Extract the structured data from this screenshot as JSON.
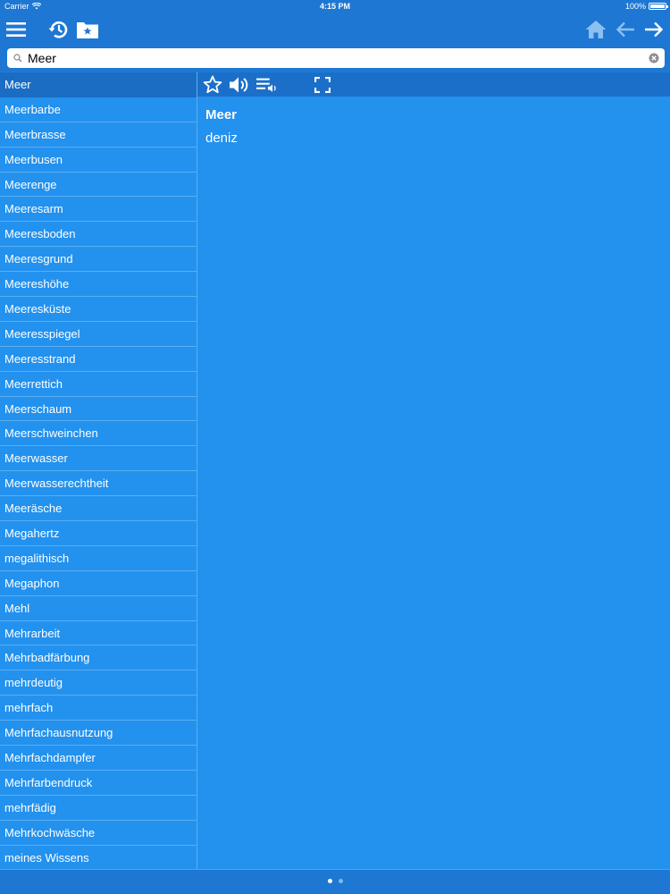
{
  "status_bar": {
    "carrier": "Carrier",
    "time": "4:15 PM",
    "battery": "100%"
  },
  "nav": {
    "icons": [
      "menu-icon",
      "history-icon",
      "bookmark-folder-icon",
      "home-icon",
      "back-arrow-icon",
      "forward-arrow-icon"
    ]
  },
  "search": {
    "value": "Meer",
    "placeholder": ""
  },
  "word_list": {
    "selected_index": 0,
    "items": [
      "Meer",
      "Meerbarbe",
      "Meerbrasse",
      "Meerbusen",
      "Meerenge",
      "Meeresarm",
      "Meeresboden",
      "Meeresgrund",
      "Meereshöhe",
      "Meeresküste",
      "Meeresspiegel",
      "Meeresstrand",
      "Meerrettich",
      "Meerschaum",
      "Meerschweinchen",
      "Meerwasser",
      "Meerwasserechtheit",
      "Meeräsche",
      "Megahertz",
      "megalithisch",
      "Megaphon",
      "Mehl",
      "Mehrarbeit",
      "Mehrbadfärbung",
      "mehrdeutig",
      "mehrfach",
      "Mehrfachausnutzung",
      "Mehrfachdampfer",
      "Mehrfarbendruck",
      "mehrfädig",
      "Mehrkochwäsche",
      "meines Wissens"
    ]
  },
  "detail": {
    "toolbar_icons": [
      "star-icon",
      "speaker-icon",
      "playlist-audio-icon",
      "fullscreen-icon"
    ],
    "entry_word": "Meer",
    "translation": "deniz"
  },
  "pager": {
    "page_count": 2,
    "active_page": 1
  },
  "colors": {
    "bar": "#1e77d2",
    "list_background": "#2391ee",
    "selected_row": "#1b6cc3",
    "separator": "#5aaef2"
  }
}
